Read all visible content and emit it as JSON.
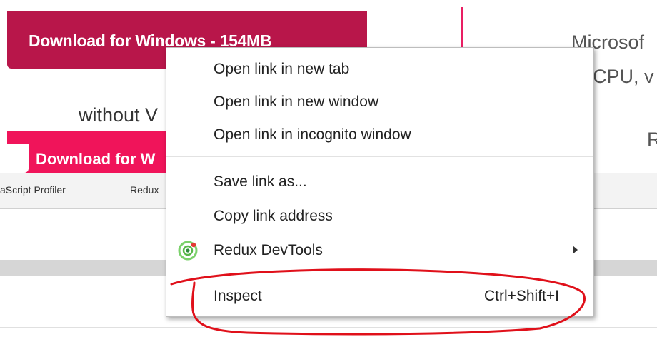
{
  "background": {
    "download_button": "Download for Windows - 154MB",
    "right_line1": "Microsof",
    "right_line2": "CPU, v",
    "right_line3": "R",
    "without_text": "without V",
    "pink_tab": "Download for W",
    "toolbar_items": [
      "aScript Profiler",
      "Redux"
    ],
    "colors": {
      "brand": "#b8164a",
      "pink": "#f0145a",
      "annotation": "#e0101a"
    }
  },
  "context_menu": {
    "group1": [
      "Open link in new tab",
      "Open link in new window",
      "Open link in incognito window"
    ],
    "group2": [
      "Save link as...",
      "Copy link address"
    ],
    "redux": {
      "label": "Redux DevTools",
      "icon": "redux-devtools-icon",
      "has_submenu": true
    },
    "inspect": {
      "label": "Inspect",
      "shortcut": "Ctrl+Shift+I"
    }
  }
}
